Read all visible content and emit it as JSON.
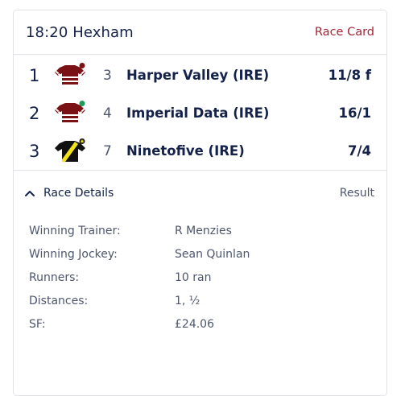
{
  "race": {
    "title": "18:20 Hexham",
    "race_card_label": "Race Card"
  },
  "results": [
    {
      "position": "1",
      "number": "3",
      "horse": "Harper Valley (IRE)",
      "odds": "11/8 f",
      "silk": {
        "body": "#7a1114",
        "stripes": "#ffffff",
        "cap": "#7a1114",
        "cap_dot": "#7a1114"
      }
    },
    {
      "position": "2",
      "number": "4",
      "horse": "Imperial Data (IRE)",
      "odds": "16/1",
      "silk": {
        "body": "#7a1114",
        "stripes": "#ffffff",
        "cap": "#7a1114",
        "cap_dot": "#1e9c5a"
      }
    },
    {
      "position": "3",
      "number": "7",
      "horse": "Ninetofive (IRE)",
      "odds": "7/4",
      "silk": {
        "body": "#111111",
        "sash": "#f2e21b",
        "cap": "#111111",
        "cap_dot": "#f2e21b"
      }
    }
  ],
  "details": {
    "toggle_label": "Race Details",
    "result_label": "Result",
    "rows": [
      {
        "label": "Winning Trainer:",
        "value": "R Menzies"
      },
      {
        "label": "Winning Jockey:",
        "value": "Sean Quinlan"
      },
      {
        "label": "Runners:",
        "value": "10 ran"
      },
      {
        "label": "Distances:",
        "value": "1, ½"
      },
      {
        "label": "SF:",
        "value": "£24.06"
      }
    ]
  },
  "colors": {
    "navy": "#14224a",
    "accent": "#a32638",
    "muted": "#4d566e",
    "border": "#e2e2e6"
  }
}
